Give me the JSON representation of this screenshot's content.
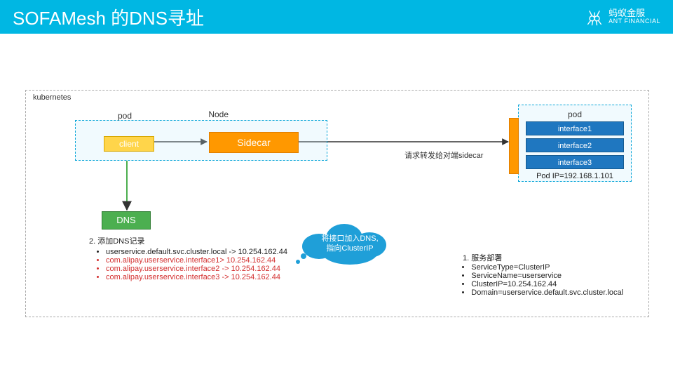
{
  "header": {
    "title": "SOFAMesh 的DNS寻址",
    "brand": "蚂蚁金服",
    "brand_sub": "ANT FINANCIAL"
  },
  "diagram": {
    "k8s": "kubernetes",
    "node": "Node",
    "pod_left": "pod",
    "client": "client",
    "sidecar": "Sidecar",
    "dns": "DNS",
    "req_label": "请求转发给对端sidecar",
    "pod_right": {
      "title": "pod",
      "ifaces": [
        "interface1",
        "interface2",
        "interface3"
      ],
      "ip_label": "Pod IP=192.168.1.101"
    },
    "cloud": {
      "line1": "将接口加入DNS,",
      "line2": "指向ClusterIP"
    },
    "dns_records": {
      "title": "2. 添加DNS记录",
      "items": [
        {
          "text": "userservice.default.svc.cluster.local -> 10.254.162.44",
          "red": false
        },
        {
          "text": "com.alipay.userservice.interface1> 10.254.162.44",
          "red": true
        },
        {
          "text": "com.alipay.userservice.interface2 -> 10.254.162.44",
          "red": true
        },
        {
          "text": "com.alipay.userservice.interface3 -> 10.254.162.44",
          "red": true
        }
      ]
    },
    "svc": {
      "title": "服务部署",
      "items": [
        "ServiceType=ClusterIP",
        "ServiceName=userservice",
        "ClusterIP=10.254.162.44",
        "Domain=userservice.default.svc.cluster.local"
      ]
    }
  }
}
